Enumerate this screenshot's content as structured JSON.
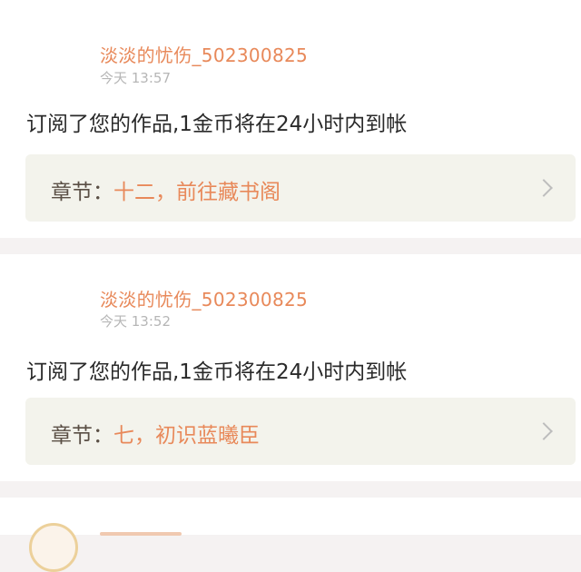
{
  "notifications": [
    {
      "sender": "淡淡的忧伤_502300825",
      "time": "今天 13:57",
      "message": "订阅了您的作品,1金币将在24小时内到帐",
      "chapter_label": "章节：",
      "chapter_title": "十二，前往藏书阁"
    },
    {
      "sender": "淡淡的忧伤_502300825",
      "time": "今天 13:52",
      "message": "订阅了您的作品,1金币将在24小时内到帐",
      "chapter_label": "章节：",
      "chapter_title": "七，初识蓝曦臣"
    }
  ],
  "colors": {
    "background": "#f5f2f2",
    "card": "#ffffff",
    "accent_orange": "#e8895a",
    "time_gray": "#b6b6b6",
    "message_text": "#2a2a2a",
    "chapter_box": "#f3f3ec",
    "top_accent_pink": "#f06aa0"
  },
  "icons": {
    "chapter_arrow": "chevron-right-icon",
    "avatar": "avatar"
  }
}
